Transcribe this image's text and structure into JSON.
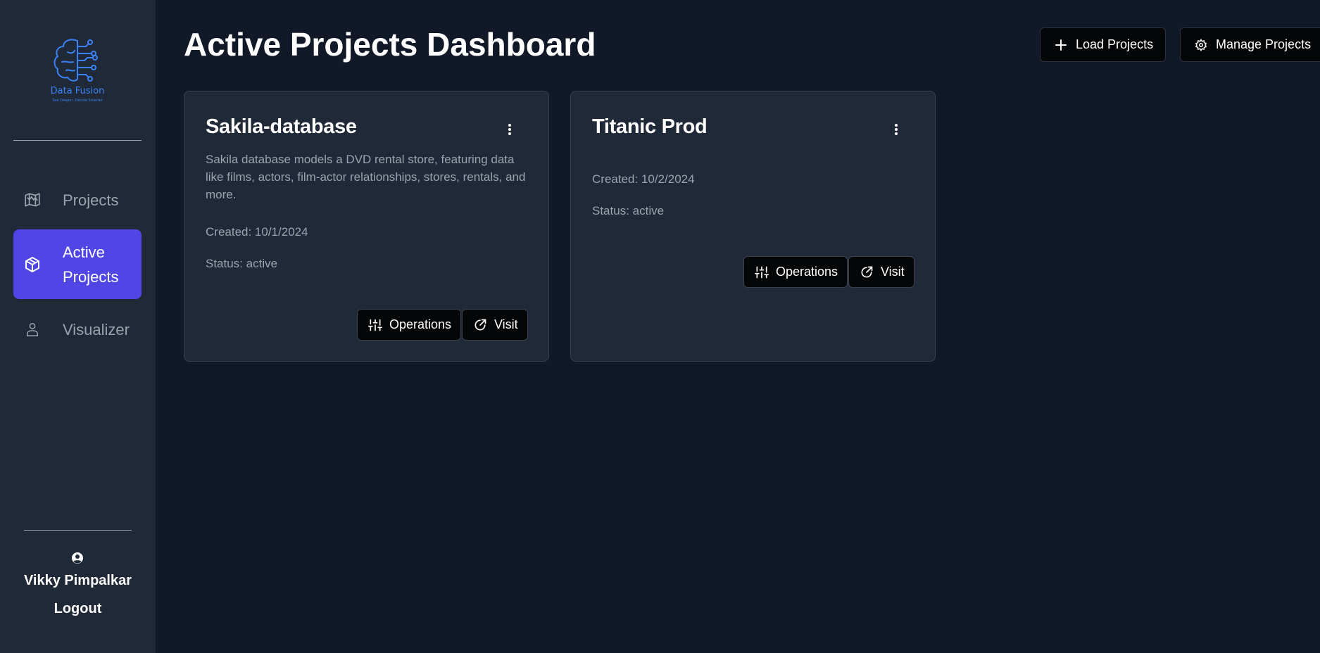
{
  "app": {
    "logo_name": "Data Fusion",
    "logo_tagline": "See Deeper, Decide Smarter",
    "brand_color": "#3b82f6",
    "accent_color": "#4f46e5"
  },
  "sidebar": {
    "items": [
      {
        "label": "Projects",
        "icon": "map-icon",
        "active": false
      },
      {
        "label": "Active Projects",
        "icon": "cube-icon",
        "active": true
      },
      {
        "label": "Visualizer",
        "icon": "user-icon",
        "active": false
      }
    ],
    "user": {
      "name": "Vikky Pimpalkar",
      "icon": "user-circle-icon"
    },
    "logout_label": "Logout"
  },
  "header": {
    "title": "Active Projects Dashboard",
    "load_label": "Load Projects",
    "manage_label": "Manage Projects"
  },
  "projects": [
    {
      "title": "Sakila-database",
      "description": "Sakila database models a DVD rental store, featuring data like films, actors, film-actor relationships, stores, rentals, and more.",
      "created": "Created: 10/1/2024",
      "status": "Status: active",
      "operations_label": "Operations",
      "visit_label": "Visit"
    },
    {
      "title": "Titanic Prod",
      "description": "",
      "created": "Created: 10/2/2024",
      "status": "Status: active",
      "operations_label": "Operations",
      "visit_label": "Visit"
    }
  ]
}
